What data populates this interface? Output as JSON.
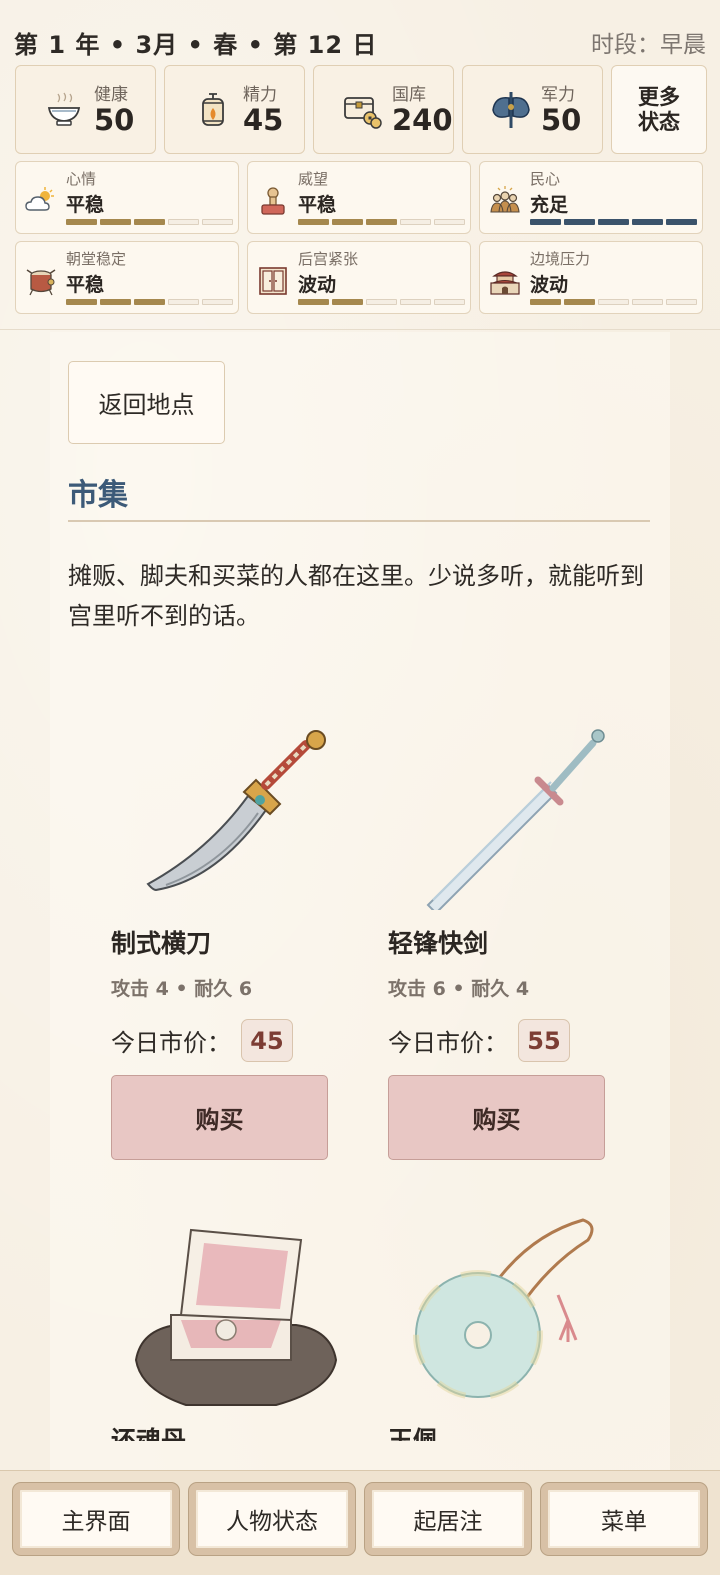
{
  "header": {
    "date": "第 1 年 • 3月 • 春 • 第 12 日",
    "period": "时段：早晨"
  },
  "resources": [
    {
      "label": "健康",
      "value": "50",
      "icon": "bowl-icon"
    },
    {
      "label": "精力",
      "value": "45",
      "icon": "lantern-icon"
    },
    {
      "label": "国库",
      "value": "240",
      "icon": "treasury-chest-icon"
    },
    {
      "label": "军力",
      "value": "50",
      "icon": "battle-axe-icon"
    }
  ],
  "more_status": {
    "line1": "更多",
    "line2": "状态"
  },
  "stats": [
    {
      "label": "心情",
      "value": "平稳",
      "level": 3,
      "max": 5,
      "color": "#a5884e",
      "icon": "weather-icon"
    },
    {
      "label": "威望",
      "value": "平稳",
      "level": 3,
      "max": 5,
      "color": "#a5884e",
      "icon": "seal-stamp-icon"
    },
    {
      "label": "民心",
      "value": "充足",
      "level": 5,
      "max": 5,
      "color": "#3b536b",
      "icon": "people-icon"
    },
    {
      "label": "朝堂稳定",
      "value": "平稳",
      "level": 3,
      "max": 5,
      "color": "#a5884e",
      "icon": "drum-icon"
    },
    {
      "label": "后宫紧张",
      "value": "波动",
      "level": 2,
      "max": 5,
      "color": "#a5884e",
      "icon": "palace-door-icon"
    },
    {
      "label": "边境压力",
      "value": "波动",
      "level": 2,
      "max": 5,
      "color": "#a5884e",
      "icon": "fortress-icon"
    }
  ],
  "location": {
    "back_label": "返回地点",
    "title": "市集",
    "description": "摊贩、脚夫和买菜的人都在这里。少说多听，就能听到宫里听不到的话。"
  },
  "shop": {
    "price_label": "今日市价：",
    "buy_label": "购买",
    "items": [
      {
        "name": "制式横刀",
        "stats": "攻击 4 • 耐久 6",
        "price": "45",
        "icon": "saber-icon"
      },
      {
        "name": "轻锋快剑",
        "stats": "攻击 6 • 耐久 4",
        "price": "55",
        "icon": "sword-icon"
      },
      {
        "name": "还魂丹",
        "icon": "pill-box-icon"
      },
      {
        "name": "玉佩",
        "icon": "jade-pendant-icon"
      }
    ]
  },
  "bottom_nav": [
    "主界面",
    "人物状态",
    "起居注",
    "菜单"
  ],
  "colors": {
    "accent_blue": "#3c5a78",
    "bar_gold": "#a5884e",
    "bar_navy": "#3b536b",
    "buy_button": "#e8c7c4"
  }
}
